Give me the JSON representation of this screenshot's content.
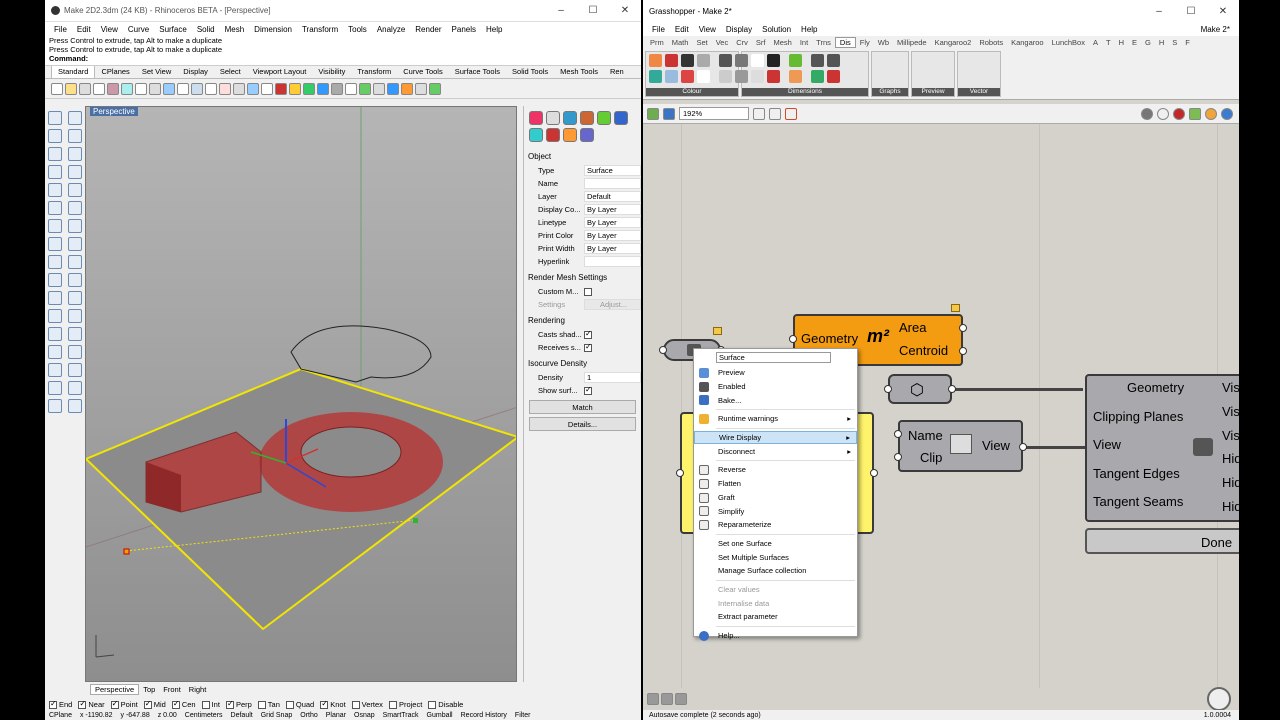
{
  "rhino": {
    "title": "Make 2D2.3dm (24 KB) - Rhinoceros BETA - [Perspective]",
    "menu": [
      "File",
      "Edit",
      "View",
      "Curve",
      "Surface",
      "Solid",
      "Mesh",
      "Dimension",
      "Transform",
      "Tools",
      "Analyze",
      "Render",
      "Panels",
      "Help"
    ],
    "cmd_history": [
      "Press Control to extrude, tap Alt to make a duplicate",
      "Press Control to extrude, tap Alt to make a duplicate"
    ],
    "cmd_prompt": "Command:",
    "toolbar_tabs": [
      "Standard",
      "CPlanes",
      "Set View",
      "Display",
      "Select",
      "Viewport Layout",
      "Visibility",
      "Transform",
      "Curve Tools",
      "Surface Tools",
      "Solid Tools",
      "Mesh Tools",
      "Ren"
    ],
    "viewport_label": "Perspective",
    "viewport_tabs": [
      "Perspective",
      "Top",
      "Front",
      "Right"
    ],
    "osnaps": [
      {
        "label": "End",
        "on": true
      },
      {
        "label": "Near",
        "on": true
      },
      {
        "label": "Point",
        "on": true
      },
      {
        "label": "Mid",
        "on": true
      },
      {
        "label": "Cen",
        "on": true
      },
      {
        "label": "Int",
        "on": false
      },
      {
        "label": "Perp",
        "on": true
      },
      {
        "label": "Tan",
        "on": false
      },
      {
        "label": "Quad",
        "on": false
      },
      {
        "label": "Knot",
        "on": true
      },
      {
        "label": "Vertex",
        "on": false
      },
      {
        "label": "Project",
        "on": false
      },
      {
        "label": "Disable",
        "on": false
      }
    ],
    "status": [
      "CPlane",
      "x -1190.82",
      "y -647.88",
      "z 0.00",
      "Centimeters",
      "Default",
      "Grid Snap",
      "Ortho",
      "Planar",
      "Osnap",
      "SmartTrack",
      "Gumball",
      "Record History",
      "Filter"
    ],
    "props": {
      "object_header": "Object",
      "rows": [
        {
          "k": "Type",
          "v": "Surface"
        },
        {
          "k": "Name",
          "v": ""
        },
        {
          "k": "Layer",
          "v": "Default"
        },
        {
          "k": "Display Co...",
          "v": "By Layer"
        },
        {
          "k": "Linetype",
          "v": "By Layer"
        },
        {
          "k": "Print Color",
          "v": "By Layer"
        },
        {
          "k": "Print Width",
          "v": "By Layer"
        },
        {
          "k": "Hyperlink",
          "v": ""
        }
      ],
      "render_mesh_header": "Render Mesh Settings",
      "custom_mesh": "Custom M...",
      "settings": "Settings",
      "adjust": "Adjust...",
      "rendering_header": "Rendering",
      "casts": "Casts shad...",
      "receives": "Receives s...",
      "isocurve_header": "Isocurve Density",
      "density_k": "Density",
      "density_v": "1",
      "show_surf": "Show surf...",
      "match": "Match",
      "details": "Details..."
    }
  },
  "gh": {
    "title": "Grasshopper - Make 2*",
    "menu": [
      "File",
      "Edit",
      "View",
      "Display",
      "Solution",
      "Help"
    ],
    "doc_name": "Make 2*",
    "tabs": [
      "Prm",
      "Math",
      "Set",
      "Vec",
      "Crv",
      "Srf",
      "Mesh",
      "Int",
      "Trns",
      "Dis",
      "Fly",
      "Wb",
      "Millipede",
      "Kangaroo2",
      "Robots",
      "Kangaroo",
      "LunchBox",
      "A",
      "T",
      "H",
      "E",
      "G",
      "H",
      "S",
      "F"
    ],
    "active_tab": "Dis",
    "panels": [
      "Colour",
      "Dimensions",
      "Graphs",
      "Preview",
      "Vector"
    ],
    "zoom": "192%",
    "area_node": {
      "input": "Geometry",
      "symbol": "m²",
      "out1": "Area",
      "out2": "Centroid"
    },
    "view_node": {
      "in1": "Name",
      "in2": "Clip",
      "out": "View"
    },
    "make2d_node": {
      "inputs": [
        "Geometry",
        "Clipping Planes",
        "View",
        "Tangent Edges",
        "Tangent Seams"
      ],
      "outputs": [
        "Vis",
        "Vis",
        "Vis",
        "Hid",
        "Hid",
        "Hid"
      ]
    },
    "done": "Done",
    "context_menu": {
      "name_value": "Surface",
      "items1": [
        {
          "label": "Preview",
          "icon": "preview-icon"
        },
        {
          "label": "Enabled",
          "icon": "enabled-icon"
        },
        {
          "label": "Bake...",
          "icon": "bake-icon"
        }
      ],
      "runtime": "Runtime warnings",
      "wire": "Wire Display",
      "disconnect": "Disconnect",
      "items2": [
        "Reverse",
        "Flatten",
        "Graft",
        "Simplify",
        "Reparameterize"
      ],
      "items3": [
        "Set one Surface",
        "Set Multiple Surfaces",
        "Manage Surface collection"
      ],
      "items4_disabled": [
        "Clear values",
        "Internalise data"
      ],
      "extract": "Extract parameter",
      "help": "Help..."
    },
    "status": "Autosave complete (2 seconds ago)",
    "version": "1.0.0004"
  }
}
